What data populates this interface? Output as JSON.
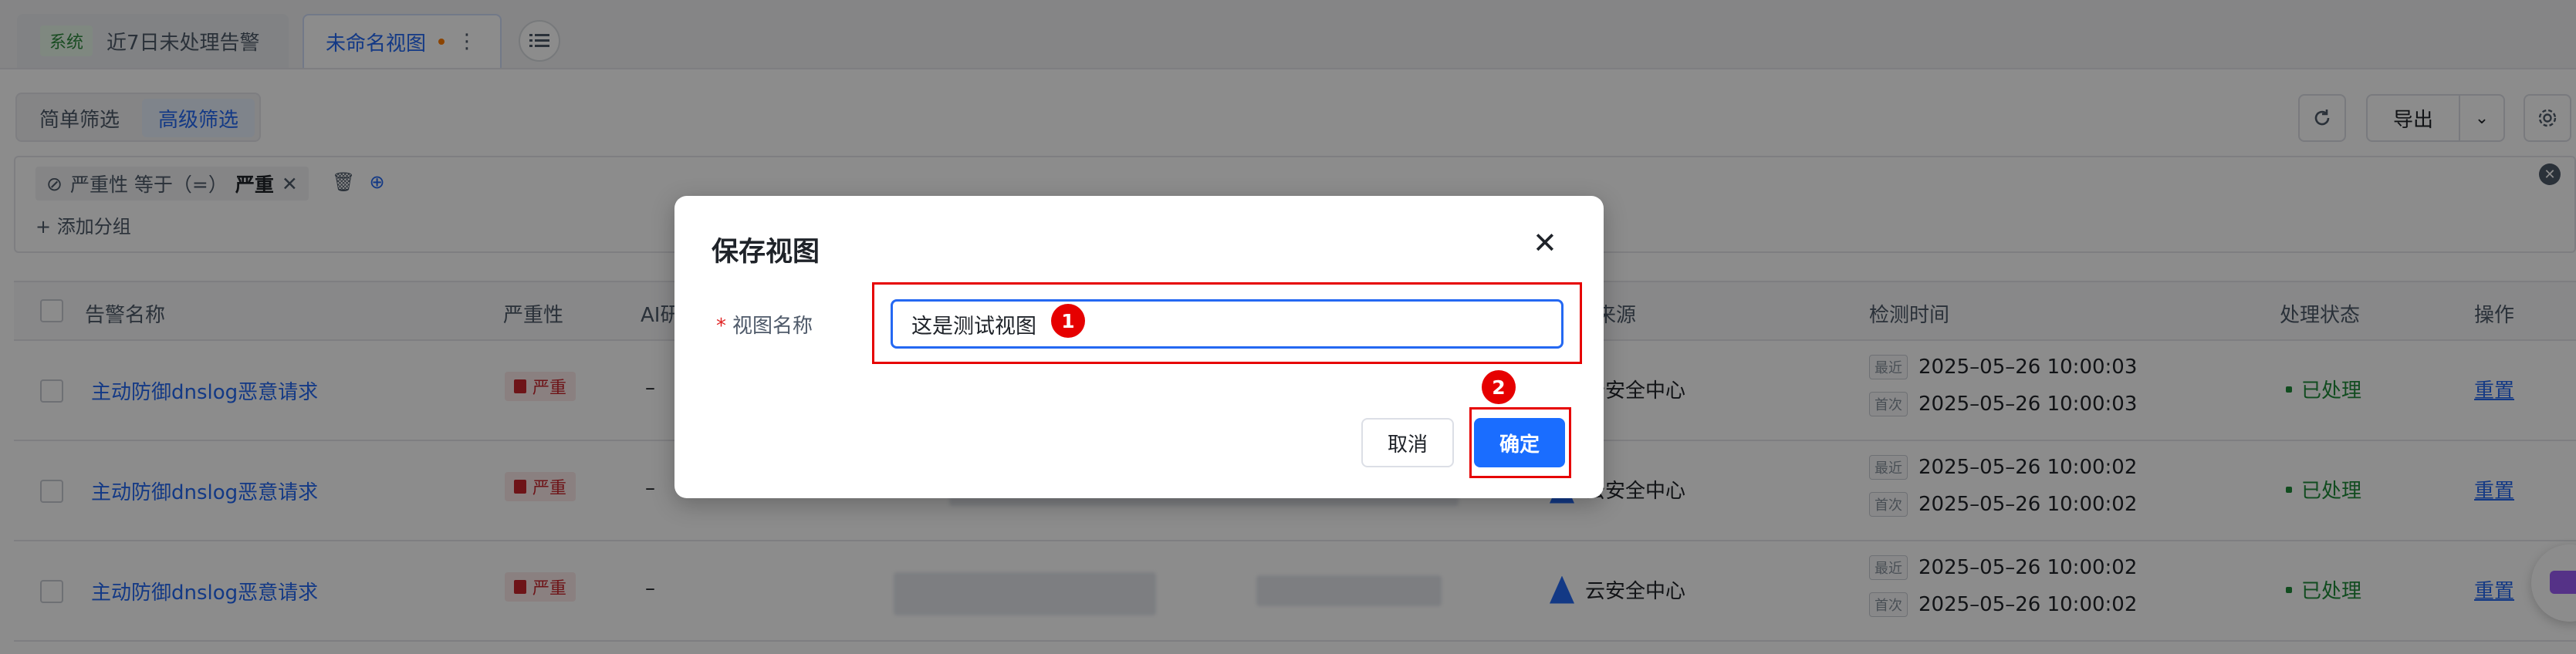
{
  "tabs": {
    "system_badge": "系统",
    "system_tab": "近7日未处理告警",
    "view_tab": "未命名视图",
    "more_icon": "⋮"
  },
  "filter": {
    "simple": "简单筛选",
    "advanced": "高级筛选",
    "export": "导出",
    "condition_field": "严重性 等于（=）",
    "condition_value": "严重",
    "add_group": "添加分组"
  },
  "table": {
    "headers": [
      "告警名称",
      "严重性",
      "AI研",
      "来源",
      "检测时间",
      "处理状态",
      "操作"
    ],
    "rows": [
      {
        "name": "主动防御dnslog恶意请求",
        "severity": "严重",
        "ai": "–",
        "source": "云安全中心",
        "recent": "2025–05–26 10:00:03",
        "first": "2025–05–26 10:00:03",
        "status": "已处理",
        "action": "重置"
      },
      {
        "name": "主动防御dnslog恶意请求",
        "severity": "严重",
        "ai": "–",
        "source": "云安全中心",
        "recent": "2025–05–26 10:00:02",
        "first": "2025–05–26 10:00:02",
        "status": "已处理",
        "action": "重置"
      },
      {
        "name": "主动防御dnslog恶意请求",
        "severity": "严重",
        "ai": "–",
        "source": "云安全中心",
        "recent": "2025–05–26 10:00:02",
        "first": "2025–05–26 10:00:02",
        "status": "已处理",
        "action": "重置"
      }
    ],
    "recent_tag": "最近",
    "first_tag": "首次"
  },
  "modal": {
    "title": "保存视图",
    "close": "✕",
    "required_mark": "*",
    "field_label": "视图名称",
    "input_value": "这是测试视图",
    "cancel": "取消",
    "confirm": "确定"
  },
  "markers": [
    "1",
    "2"
  ],
  "colors": {
    "accent": "#1a6dff",
    "highlight": "#e60000",
    "severity": "#c9252c",
    "status_ok": "#1f8b3a"
  }
}
